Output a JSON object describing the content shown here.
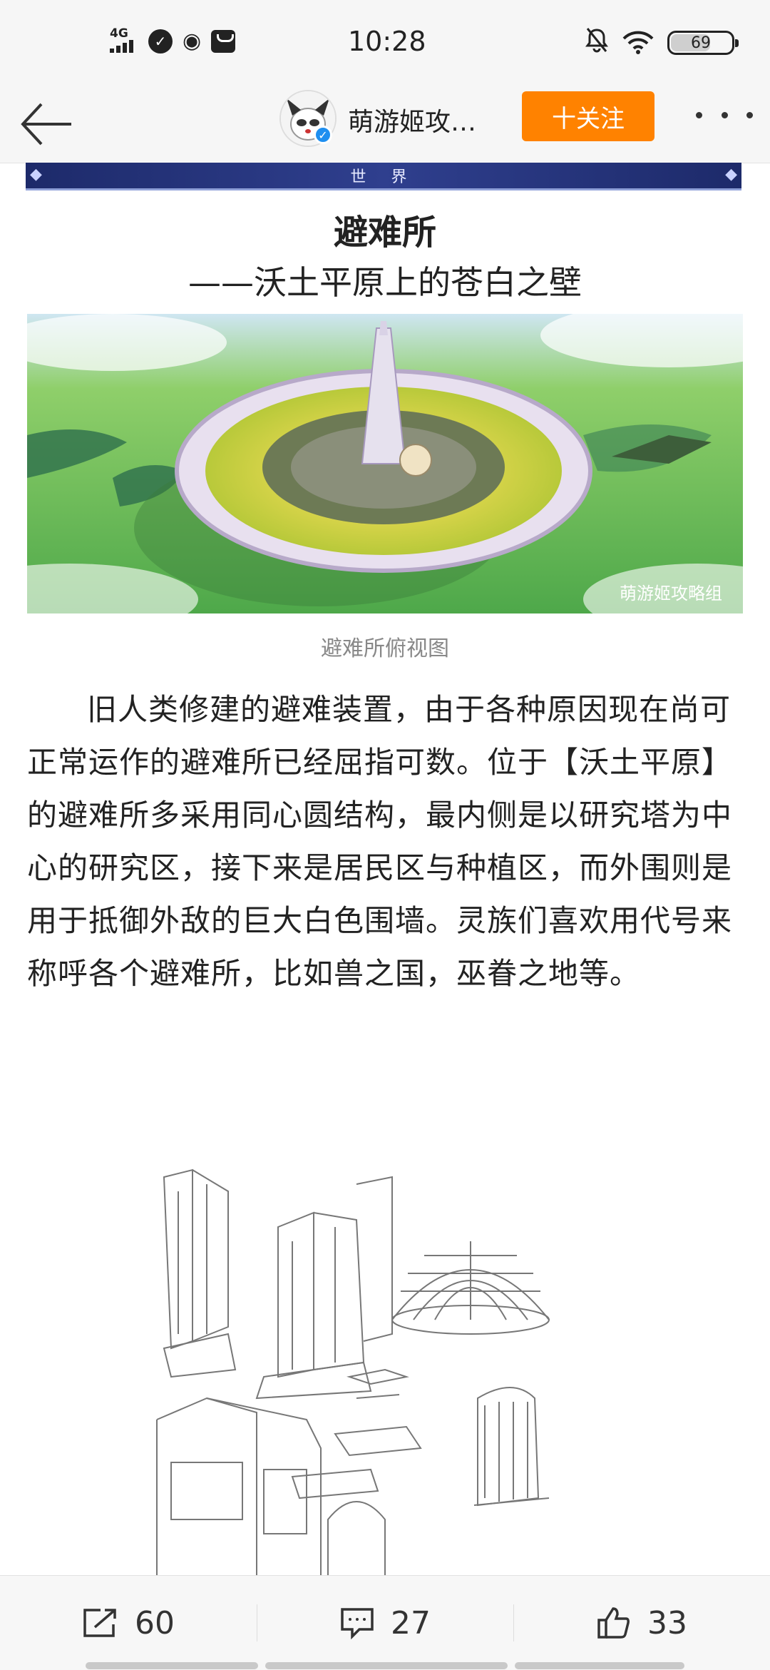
{
  "status_bar": {
    "network": "4G",
    "time": "10:28",
    "battery": "69",
    "icons": [
      "signal-icon",
      "message-icon",
      "weibo-icon",
      "bag-icon",
      "mute-bell-icon",
      "wifi-icon",
      "battery-icon"
    ]
  },
  "navbar": {
    "account_name": "萌游姬攻…",
    "follow_label": "十关注",
    "icons": [
      "back-arrow-icon",
      "avatar",
      "verified-icon",
      "more-icon"
    ]
  },
  "article": {
    "banner_text": "世  界",
    "title": "避难所",
    "subtitle": "——沃土平原上的苍白之壁",
    "image_watermark": "萌游姬攻略组",
    "image_caption": "避难所俯视图",
    "paragraph": "旧人类修建的避难装置，由于各种原因现在尚可正常运作的避难所已经屈指可数。位于【沃土平原】的避难所多采用同心圆结构，最内侧是以研究塔为中心的研究区，接下来是居民区与种植区，而外围则是用于抵御外敌的巨大白色围墙。灵族们喜欢用代号来称呼各个避难所，比如兽之国，巫眷之地等。"
  },
  "bottom_bar": {
    "repost_count": "60",
    "comment_count": "27",
    "like_count": "33"
  },
  "colors": {
    "accent_orange": "#ff8200",
    "verified_blue": "#1f8ff0",
    "banner_navy": "#1d2a6a"
  }
}
